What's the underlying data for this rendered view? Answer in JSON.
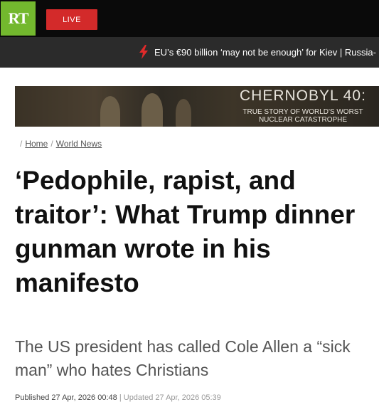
{
  "header": {
    "logo": "RT",
    "live_label": "LIVE",
    "ticker_text": "EU’s €90 billion ‘may not be enough’ for Kiev | Russia-"
  },
  "banner": {
    "title": "CHERNOBYL 40:",
    "subtitle": "TRUE STORY OF WORLD'S WORST NUCLEAR CATASTROPHE"
  },
  "breadcrumb": {
    "items": [
      "Home",
      "World News"
    ]
  },
  "article": {
    "headline": "‘Pedophile, rapist, and traitor’: What Trump dinner gunman wrote in his manifesto",
    "summary": "The US president has called Cole Allen a “sick man” who hates Christians",
    "published_label": "Published",
    "published_date": "27 Apr, 2026 00:48",
    "updated_label": "Updated",
    "updated_date": "27 Apr, 2026 05:39"
  },
  "colors": {
    "brand": "#73b82e",
    "live": "#d32a2a",
    "header_bg": "#0a0a0a",
    "ticker_bg": "#2b2b2b"
  }
}
